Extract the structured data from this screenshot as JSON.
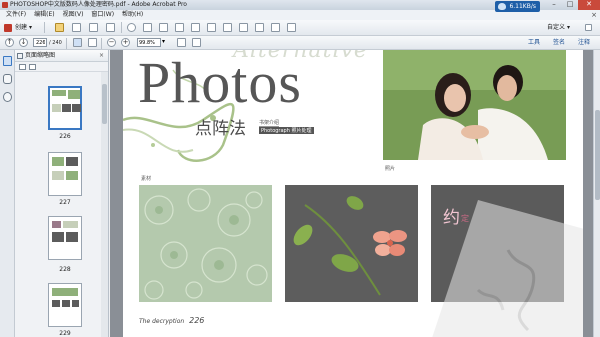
{
  "window": {
    "title": "PHOTOSHOP中文版数码人像处理密码.pdf - Adobe Acrobat Pro",
    "minimize": "–",
    "restore": "□",
    "close": "✕"
  },
  "menu": {
    "items": [
      "文件(F)",
      "编辑(E)",
      "视图(V)",
      "窗口(W)",
      "帮助(H)"
    ],
    "close_doc": "×"
  },
  "network_badge": "6.11KB/s",
  "toolbar": {
    "create_label": "创建",
    "customize_label": "自定义",
    "tools_label": "工具",
    "sign_label": "签名",
    "comment_label": "注释"
  },
  "navigation": {
    "current_page": "226",
    "total_pages": "/ 240",
    "zoom": "99.8%"
  },
  "panel": {
    "title": "页面缩略图",
    "close": "×",
    "thumbnails": [
      {
        "label": "226",
        "selected": true
      },
      {
        "label": "227",
        "selected": false
      },
      {
        "label": "228",
        "selected": false
      },
      {
        "label": "229",
        "selected": false
      }
    ]
  },
  "page": {
    "headline_alt": "Alternative",
    "headline": "Photos",
    "subtitle": "点阵法",
    "sub_en1": "书架介绍",
    "sub_en2": "Photograph 照片处理",
    "photo_label": "照片",
    "material_label": "素材",
    "graphic_char": "约",
    "graphic_char2": "定",
    "footer_text": "The decryption",
    "footer_number": "226"
  },
  "colors": {
    "accent_blue": "#1e5fa8",
    "close_red": "#c94a3b",
    "page_gray": "#8a8f96"
  }
}
